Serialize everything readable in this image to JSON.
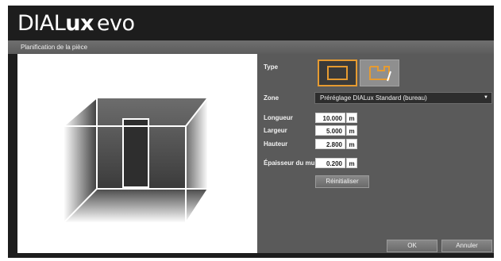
{
  "brand": {
    "part1": "DIAL",
    "part2": "ux",
    "part3": "evo"
  },
  "dialog": {
    "title": "Planification de la pièce"
  },
  "form": {
    "type_label": "Type",
    "zone_label": "Zone",
    "zone_value": "Préréglage DIALux Standard (bureau)",
    "fields": [
      {
        "label": "Longueur",
        "value": "10.000",
        "unit": "m"
      },
      {
        "label": "Largeur",
        "value": "5.000",
        "unit": "m"
      },
      {
        "label": "Hauteur",
        "value": "2.800",
        "unit": "m"
      },
      {
        "label": "Épaisseur du mur",
        "value": "0.200",
        "unit": "m"
      }
    ],
    "reset_label": "Réinitialiser"
  },
  "footer": {
    "ok_label": "OK",
    "cancel_label": "Annuler"
  },
  "colors": {
    "accent": "#e69b31",
    "panel": "#5a5a5a",
    "header": "#1d1d1d"
  },
  "icons": {
    "type_rect": "rectangle-room-icon",
    "type_custom": "custom-room-edit-icon",
    "dropdown": "dropdown-arrow-icon"
  }
}
